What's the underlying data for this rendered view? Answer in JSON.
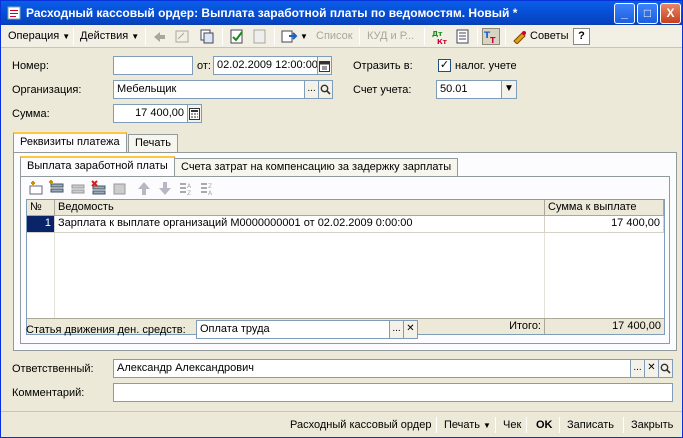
{
  "window": {
    "title": "Расходный кассовый ордер: Выплата заработной платы по ведомостям. Новый *",
    "minimize": "_",
    "maximize": "□",
    "close": "X"
  },
  "toolbar": {
    "operation": "Операция",
    "actions": "Действия",
    "list": "Список",
    "kud": "КУД и Р...",
    "tips": "Советы",
    "help": "?"
  },
  "form": {
    "number_label": "Номер:",
    "number_value": "",
    "date_from_label": "от:",
    "date_value": "02.02.2009 12:00:00",
    "reflect_label": "Отразить в:",
    "tax_label": "налог. учете",
    "tax_checked": "✓",
    "org_label": "Организация:",
    "org_value": "Мебельщик",
    "account_label": "Счет учета:",
    "account_value": "50.01",
    "sum_label": "Сумма:",
    "sum_value": "17 400,00",
    "select_btn": "...",
    "search_btn": "🔍",
    "clear_btn": "✕"
  },
  "tabs": {
    "outer": [
      "Реквизиты платежа",
      "Печать"
    ],
    "inner": [
      "Выплата заработной платы",
      "Счета затрат на компенсацию за задержку зарплаты"
    ]
  },
  "grid": {
    "columns": [
      "№",
      "Ведомость",
      "Сумма к выплате"
    ],
    "rows": [
      {
        "num": "1",
        "statement": "Зарплата к выплате организаций М0000000001 от 02.02.2009 0:00:00",
        "amount": "17 400,00"
      }
    ],
    "total_label": "Итого:",
    "total_value": "17 400,00"
  },
  "cashflow": {
    "label": "Статья движения ден. средств:",
    "value": "Оплата труда"
  },
  "responsible": {
    "label": "Ответственный:",
    "value": "Александр Александрович"
  },
  "comment": {
    "label": "Комментарий:",
    "value": ""
  },
  "bottom": {
    "print_form": "Расходный кассовый ордер",
    "print": "Печать",
    "check": "Чек",
    "ok": "OK",
    "save": "Записать",
    "close": "Закрыть"
  }
}
